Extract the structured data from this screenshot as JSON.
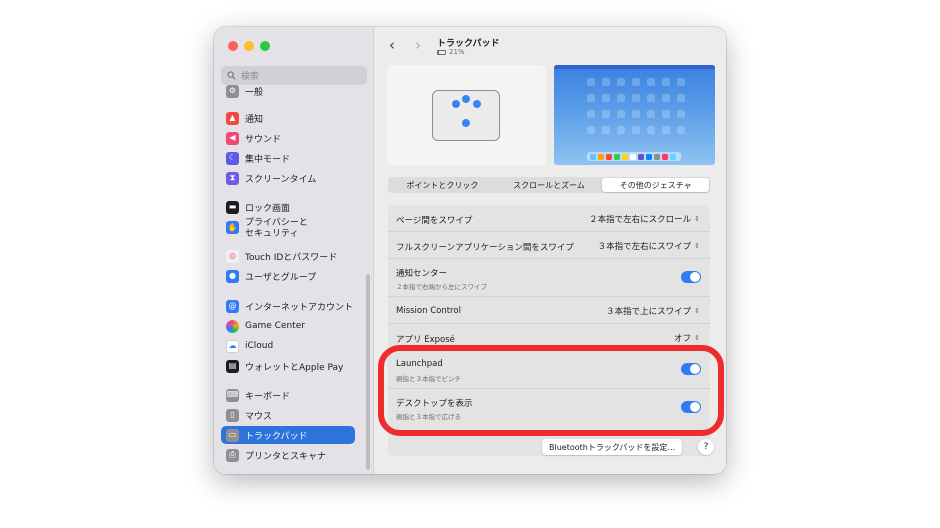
{
  "window": {
    "title": "トラックパッド",
    "battery": "21%",
    "battery_level": 0.21
  },
  "sidebar": {
    "search_placeholder": "検索",
    "items": [
      {
        "label": "一般",
        "icon": "gear-icon",
        "color": "#8e8e93"
      },
      {
        "label": "通知",
        "icon": "bell-icon",
        "color": "#f04a44"
      },
      {
        "label": "サウンド",
        "icon": "speaker-icon",
        "color": "#f04a73"
      },
      {
        "label": "集中モード",
        "icon": "moon-icon",
        "color": "#5e5ce6"
      },
      {
        "label": "スクリーンタイム",
        "icon": "hourglass-icon",
        "color": "#6c5ce7"
      },
      {
        "label": "ロック画面",
        "icon": "lock-screen-icon",
        "color": "#1d1d1f"
      },
      {
        "label": "プライバシーと\nセキュリティ",
        "icon": "hand-icon",
        "color": "#2f7bf4"
      },
      {
        "label": "Touch IDとパスワード",
        "icon": "fingerprint-icon",
        "color": "#f0f0f0"
      },
      {
        "label": "ユーザとグループ",
        "icon": "users-icon",
        "color": "#2f7bf4"
      },
      {
        "label": "インターネットアカウント",
        "icon": "at-icon",
        "color": "#2f7bf4"
      },
      {
        "label": "Game Center",
        "icon": "game-center-icon",
        "color": "#f0f0f0"
      },
      {
        "label": "iCloud",
        "icon": "cloud-icon",
        "color": "#ffffff"
      },
      {
        "label": "ウォレットとApple Pay",
        "icon": "wallet-icon",
        "color": "#1d1d1f"
      },
      {
        "label": "キーボード",
        "icon": "keyboard-icon",
        "color": "#8e8e93"
      },
      {
        "label": "マウス",
        "icon": "mouse-icon",
        "color": "#8e8e93"
      },
      {
        "label": "トラックパッド",
        "icon": "trackpad-icon",
        "color": "#8e8e93",
        "active": true
      },
      {
        "label": "プリンタとスキャナ",
        "icon": "printer-icon",
        "color": "#8e8e93"
      }
    ]
  },
  "tabs": [
    "ポイントとクリック",
    "スクロールとズーム",
    "その他のジェスチャ"
  ],
  "active_tab": 2,
  "settings": [
    {
      "title": "ページ間をスワイプ",
      "value": "２本指で左右にスクロール",
      "control": "popup"
    },
    {
      "title": "フルスクリーンアプリケーション間をスワイプ",
      "value": "３本指で左右にスワイプ",
      "control": "popup"
    },
    {
      "title": "通知センター",
      "subtitle": "２本指で右端から左にスワイプ",
      "control": "toggle",
      "on": true
    },
    {
      "title": "Mission Control",
      "value": "３本指で上にスワイプ",
      "control": "popup"
    },
    {
      "title": "アプリ Exposé",
      "value": "オフ",
      "control": "popup"
    },
    {
      "title": "Launchpad",
      "subtitle": "親指と３本指でピンチ",
      "control": "toggle",
      "on": true
    },
    {
      "title": "デスクトップを表示",
      "subtitle": "親指と３本指で広げる",
      "control": "toggle",
      "on": true
    }
  ],
  "buttons": {
    "bluetooth": "Bluetoothトラックパッドを設定…",
    "help": "?"
  },
  "colors": {
    "accent": "#2f7bf4",
    "highlight": "#ee2c2c",
    "sidebar_active": "#2d73dc"
  }
}
